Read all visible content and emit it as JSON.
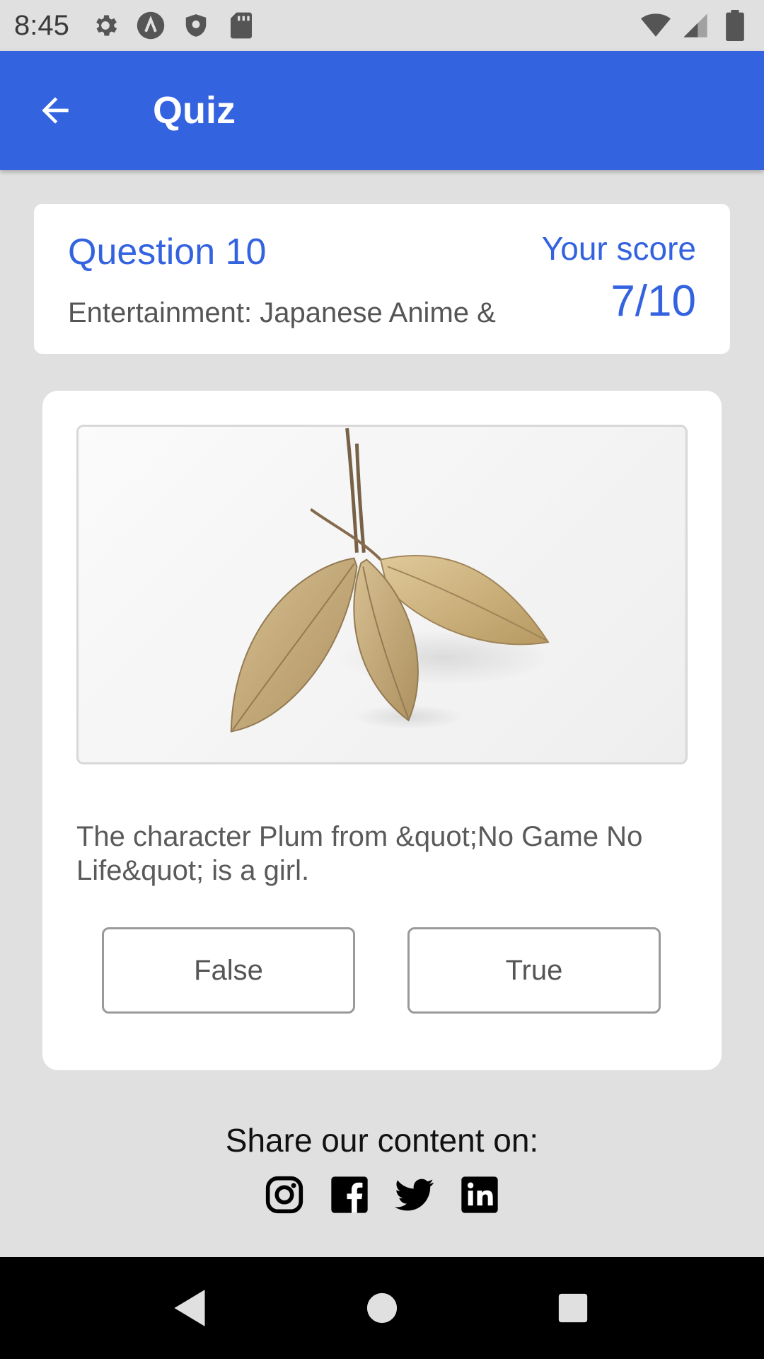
{
  "status_bar": {
    "time": "8:45",
    "icons_left": [
      "settings-gear-icon",
      "app-a-icon",
      "shield-icon",
      "sd-card-icon"
    ],
    "icons_right": [
      "wifi-icon",
      "cell-signal-icon",
      "battery-icon"
    ]
  },
  "app_bar": {
    "title": "Quiz",
    "background": "#3463e0"
  },
  "quiz_header": {
    "question_number": "Question 10",
    "category": "Entertainment: Japanese Anime &",
    "score_label": "Your score",
    "score_value": "7/10"
  },
  "question": {
    "text": "The character Plum from &quot;No Game No Life&quot; is a girl.",
    "answers": [
      "False",
      "True"
    ]
  },
  "share": {
    "label": "Share our content on:",
    "icons": [
      "instagram-icon",
      "facebook-icon",
      "twitter-icon",
      "linkedin-icon"
    ]
  },
  "colors": {
    "accent": "#3463e0",
    "background": "#e0e0e0",
    "card": "#ffffff"
  }
}
